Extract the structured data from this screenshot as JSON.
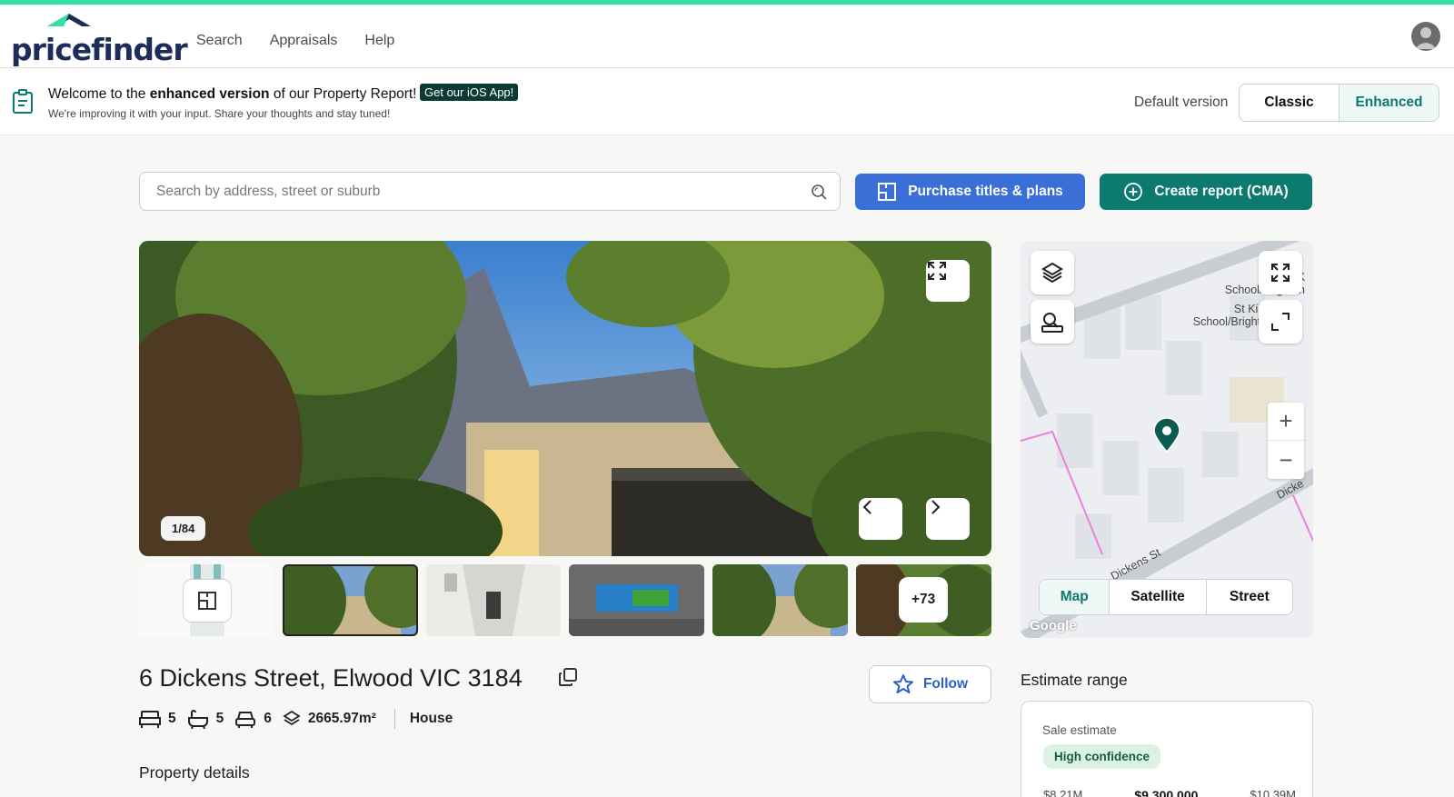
{
  "brand": {
    "name": "pricefinder",
    "accent": "#33e0a8",
    "navy": "#1c2d5a",
    "teal": "#0c7a6f",
    "blue": "#3b6fd8"
  },
  "nav": {
    "links": [
      "Search",
      "Appraisals",
      "Help"
    ]
  },
  "banner": {
    "title_pre": "Welcome to the ",
    "title_bold": "enhanced version",
    "title_post": " of our Property Report!",
    "ios_button": "Get our iOS App!",
    "subtitle": "We're improving it with your input. Share your thoughts and stay tuned!",
    "default_label": "Default version",
    "versions": [
      "Classic",
      "Enhanced"
    ],
    "selected_version": "Enhanced"
  },
  "search": {
    "placeholder": "Search by address, street or suburb"
  },
  "actions": {
    "purchase": "Purchase titles & plans",
    "create_report": "Create report (CMA)"
  },
  "gallery": {
    "counter": "1/84",
    "more_count": "+73"
  },
  "map": {
    "labels": [
      "St K",
      "School/Brighton",
      "St Kilda",
      "School/Brighton",
      "Dickens St",
      "Dicke"
    ],
    "types": [
      "Map",
      "Satellite",
      "Street"
    ],
    "selected_type": "Map",
    "zoom_in": "+",
    "zoom_out": "−",
    "attribution": "Google"
  },
  "property": {
    "address": "6 Dickens Street, Elwood VIC 3184",
    "follow": "Follow",
    "beds": "5",
    "baths": "5",
    "cars": "6",
    "land": "2665.97m²",
    "type": "House",
    "section_title": "Property details"
  },
  "estimate": {
    "title": "Estimate range",
    "label": "Sale estimate",
    "confidence": "High confidence",
    "low": "$8.21M",
    "mid": "$9,300,000",
    "high": "$10.39M"
  }
}
